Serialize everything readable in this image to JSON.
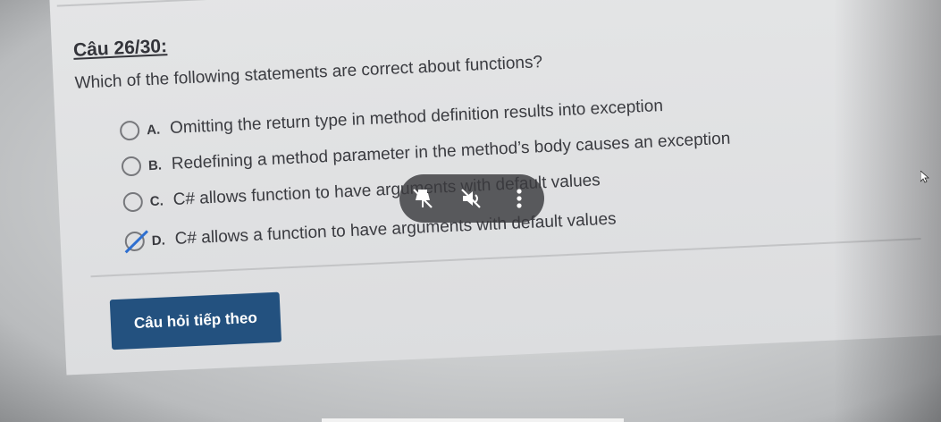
{
  "question": {
    "number": "Câu 26/30:",
    "text": "Which of the following statements are correct about functions?"
  },
  "options": [
    {
      "letter": "A.",
      "text": "Omitting the return type in method definition results into exception",
      "selected": false
    },
    {
      "letter": "B.",
      "text": "Redefining a method parameter in the method’s body causes an exception",
      "selected": false
    },
    {
      "letter": "C.",
      "text": "C# allows function to have arguments with default values",
      "selected": false
    },
    {
      "letter": "D.",
      "text": "C# allows a function to have arguments with default values",
      "selected": true
    }
  ],
  "next_button": {
    "label": "Câu hỏi tiếp theo"
  },
  "media_overlay": {
    "icons": [
      "unpin-icon",
      "mute-icon",
      "more-vertical-icon"
    ]
  },
  "colors": {
    "button_bg": "#23517f",
    "selected_mark": "#2e6fd0",
    "overlay_bg": "#3a3a3e"
  }
}
